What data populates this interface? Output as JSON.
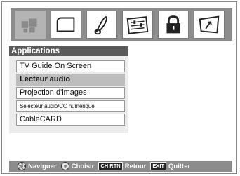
{
  "icon_tabs": [
    {
      "icon": "applications-icon",
      "selected": true
    },
    {
      "icon": "picture-icon",
      "selected": false
    },
    {
      "icon": "music-note-icon",
      "selected": false
    },
    {
      "icon": "settings-sliders-icon",
      "selected": false
    },
    {
      "icon": "lock-icon",
      "selected": false
    },
    {
      "icon": "setup-arrow-icon",
      "selected": false
    }
  ],
  "menu": {
    "title": "Applications",
    "items": [
      {
        "label": "TV Guide On Screen",
        "selected": false
      },
      {
        "label": "Lecteur audio",
        "selected": true
      },
      {
        "label": "Projection d'images",
        "selected": false
      },
      {
        "label": "Sélecteur audio/CC numérique",
        "selected": false
      },
      {
        "label": "CableCARD",
        "selected": false
      }
    ]
  },
  "hints": {
    "navigate_label": "Naviguer",
    "choose_label": "Choisir",
    "return_key": "CH RTN",
    "return_label": "Retour",
    "exit_key": "EXIT",
    "exit_label": "Quitter"
  },
  "colors": {
    "icon_bar": "#8c8c8c",
    "menu_header": "#5a5a5a",
    "selected_item": "#bdbdbd",
    "bottom_bar": "#8c8c8c"
  }
}
